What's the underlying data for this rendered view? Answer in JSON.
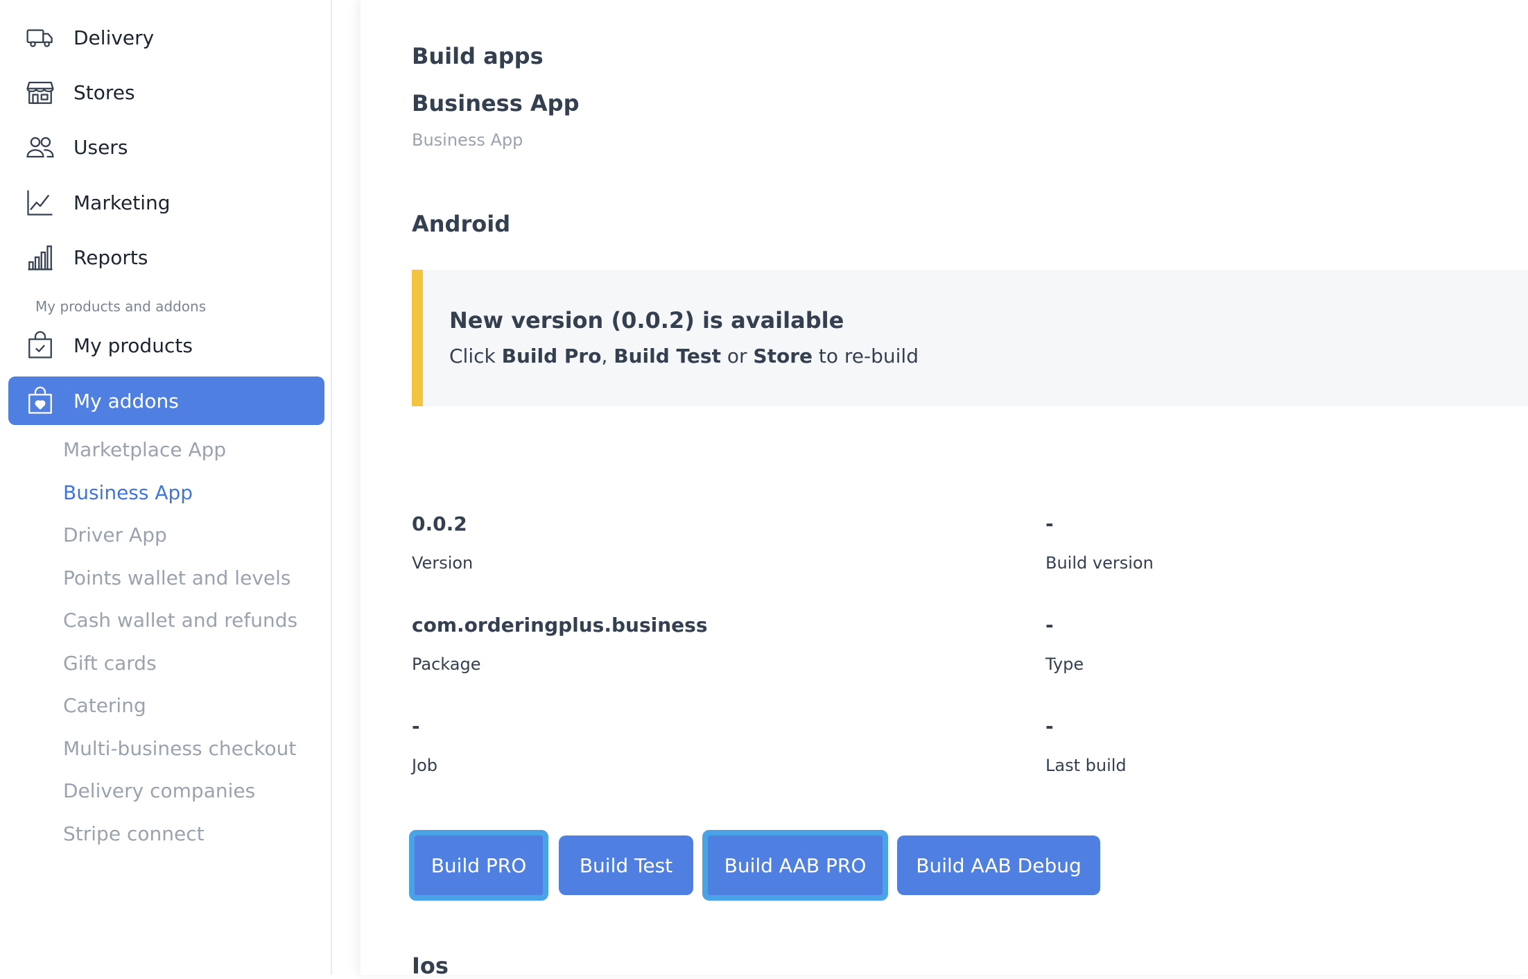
{
  "sidebar": {
    "nav": [
      {
        "label": "Delivery",
        "icon": "truck-icon"
      },
      {
        "label": "Stores",
        "icon": "store-icon"
      },
      {
        "label": "Users",
        "icon": "users-icon"
      },
      {
        "label": "Marketing",
        "icon": "chart-line-icon"
      },
      {
        "label": "Reports",
        "icon": "bar-chart-icon"
      }
    ],
    "section_label": "My products and addons",
    "products": {
      "label": "My products",
      "icon": "shopping-bag-check-icon"
    },
    "addons": {
      "label": "My addons",
      "icon": "shopping-bag-heart-icon"
    },
    "addon_items": [
      "Marketplace App",
      "Business App",
      "Driver App",
      "Points wallet and levels",
      "Cash wallet and refunds",
      "Gift cards",
      "Catering",
      "Multi-business checkout",
      "Delivery companies",
      "Stripe connect"
    ],
    "active_addon": "Business App"
  },
  "main": {
    "title": "Build apps",
    "app_title": "Business App",
    "app_subtitle": "Business App",
    "android_heading": "Android",
    "notice": {
      "title": "New version (0.0.2) is available",
      "text_prefix": "Click ",
      "bold1": "Build Pro",
      "sep1": ", ",
      "bold2": "Build Test",
      "sep2": " or ",
      "bold3": "Store",
      "text_suffix": " to re-build"
    },
    "info": {
      "version": {
        "value": "0.0.2",
        "label": "Version"
      },
      "build_version": {
        "value": "-",
        "label": "Build version"
      },
      "package": {
        "value": "com.orderingplus.business",
        "label": "Package"
      },
      "type": {
        "value": "-",
        "label": "Type"
      },
      "job": {
        "value": "-",
        "label": "Job"
      },
      "last_build": {
        "value": "-",
        "label": "Last build"
      }
    },
    "buttons": {
      "build_pro": "Build PRO",
      "build_test": "Build Test",
      "build_aab_pro": "Build AAB PRO",
      "build_aab_debug": "Build AAB Debug"
    },
    "ios_heading": "Ios"
  },
  "colors": {
    "accent": "#4f7fe1",
    "notice_bar": "#f3c53f",
    "focus_ring": "#4aa3e6",
    "active_link": "#3f74dc"
  }
}
